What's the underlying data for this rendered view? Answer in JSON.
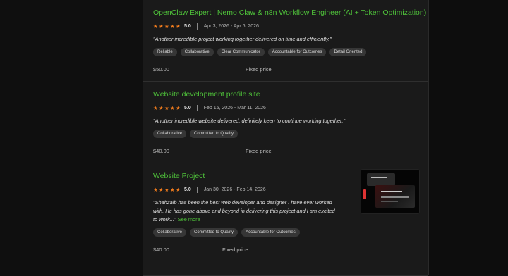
{
  "reviews": [
    {
      "title": "OpenClaw Expert | Nemo Claw & n8n Workflow Engineer (AI + Token Optimization)",
      "rating": "5.0",
      "dates": "Apr 3, 2026 - Apr 6, 2026",
      "quote": "\"Another incredible project working together delivered on time and efficiently.\"",
      "tags": [
        "Reliable",
        "Collaborative",
        "Clear Communicator",
        "Accountable for Outcomes",
        "Detail Oriented"
      ],
      "amount": "$50.00",
      "price_type": "Fixed price"
    },
    {
      "title": "Website development profile site",
      "rating": "5.0",
      "dates": "Feb 15, 2026 - Mar 11, 2026",
      "quote": "\"Another incredible website delivered, definitely keen to continue working together.\"",
      "tags": [
        "Collaborative",
        "Committed to Quality"
      ],
      "amount": "$40.00",
      "price_type": "Fixed price"
    },
    {
      "title": "Website Project",
      "rating": "5.0",
      "dates": "Jan 30, 2026 - Feb 14, 2026",
      "quote": "\"Shahzaib has been the best web developer and designer I have ever worked with. He has gone above and beyond in delivering this project and I am excited to work...\"",
      "see_more": "See more",
      "tags": [
        "Collaborative",
        "Committed to Quality",
        "Accountable for Outcomes"
      ],
      "amount": "$40.00",
      "price_type": "Fixed price"
    }
  ],
  "colors": {
    "accent": "#4fc33a",
    "star": "#f07b1d",
    "background": "#1a1a1a"
  }
}
